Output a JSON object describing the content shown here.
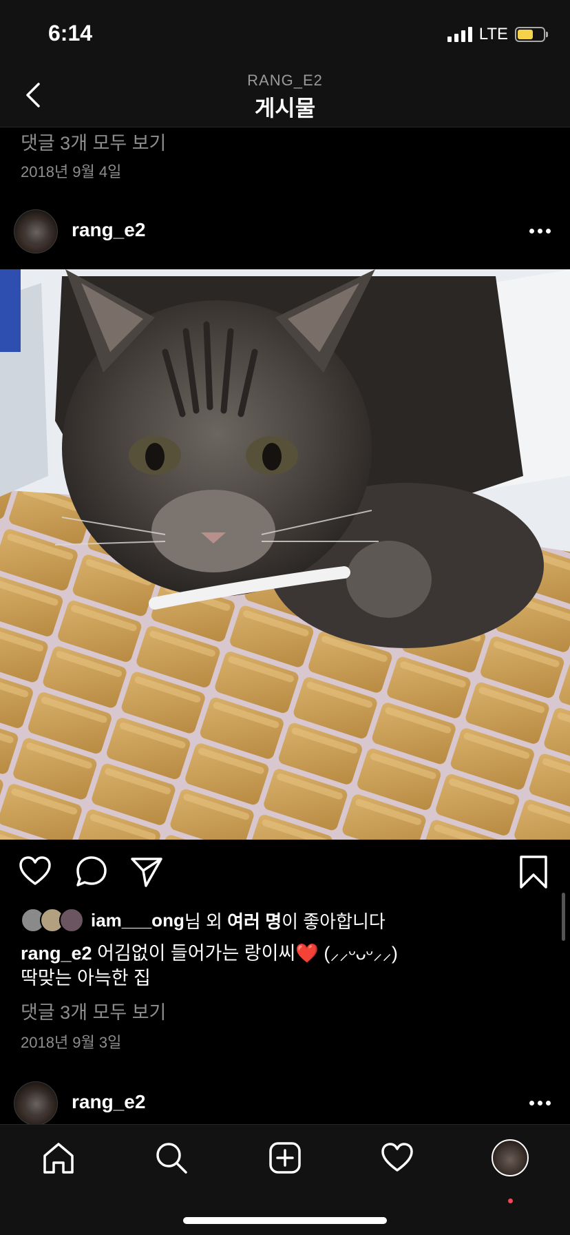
{
  "status": {
    "time": "6:14",
    "network": "LTE"
  },
  "header": {
    "account": "RANG_E2",
    "title": "게시물"
  },
  "previous_post": {
    "comments_link": "댓글 3개 모두 보기",
    "date": "2018년 9월 4일"
  },
  "post": {
    "username": "rang_e2",
    "likes": {
      "liker": "iam___ong",
      "suffix_1": "님 외 ",
      "others": "여러 명",
      "suffix_2": "이 좋아합니다"
    },
    "caption_user": "rang_e2",
    "caption_line1": " 어김없이 들어가는 랑이씨❤️ (⸝⸝ᵕᴗᵕ⸝⸝)",
    "caption_line2": "딱맞는 아늑한 집",
    "comments_link": "댓글 3개 모두 보기",
    "date": "2018년 9월 3일"
  },
  "next_post": {
    "username": "rang_e2"
  },
  "icons": {
    "back": "chevron-left-icon",
    "more": "more-icon",
    "like": "heart-icon",
    "comment": "comment-icon",
    "share": "paper-plane-icon",
    "save": "bookmark-icon",
    "tabs": [
      "home-icon",
      "search-icon",
      "add-post-icon",
      "activity-heart-icon",
      "profile-avatar"
    ]
  },
  "colors": {
    "background": "#000000",
    "bar": "#121212",
    "muted_text": "#8e8e8e",
    "notification": "#ed4956",
    "battery": "#f4d34a"
  }
}
